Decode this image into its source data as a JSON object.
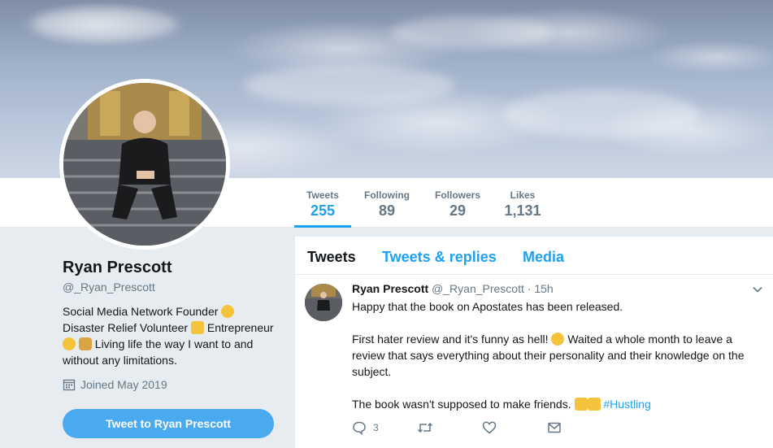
{
  "profile": {
    "name": "Ryan Prescott",
    "handle": "@_Ryan_Prescott",
    "bio_line1": "Social Media Network Founder",
    "bio_line2": "Disaster Relief Volunteer",
    "bio_line2b": "Entrepreneur",
    "bio_line3": "Living life the way I want to and",
    "bio_line4": "without any limitations.",
    "joined": "Joined May 2019",
    "tweet_button": "Tweet to Ryan Prescott"
  },
  "stats": [
    {
      "label": "Tweets",
      "value": "255"
    },
    {
      "label": "Following",
      "value": "89"
    },
    {
      "label": "Followers",
      "value": "29"
    },
    {
      "label": "Likes",
      "value": "1,131"
    }
  ],
  "tabs": [
    "Tweets",
    "Tweets & replies",
    "Media"
  ],
  "tweet": {
    "name": "Ryan Prescott",
    "handle": "@_Ryan_Prescott",
    "separator": "·",
    "time": "15h",
    "para1": "Happy that the book on Apostates has been released.",
    "para2a": "First hater review and it's funny as hell!",
    "para2b": "Waited a whole month to leave a review that says everything about their personality and their knowledge on the subject.",
    "para3": "The book wasn't supposed to make friends.",
    "hashtag": "#Hustling",
    "reply_count": "3"
  },
  "colors": {
    "accent": "#1da1f2",
    "muted": "#657786",
    "button": "#4aaaf0"
  }
}
